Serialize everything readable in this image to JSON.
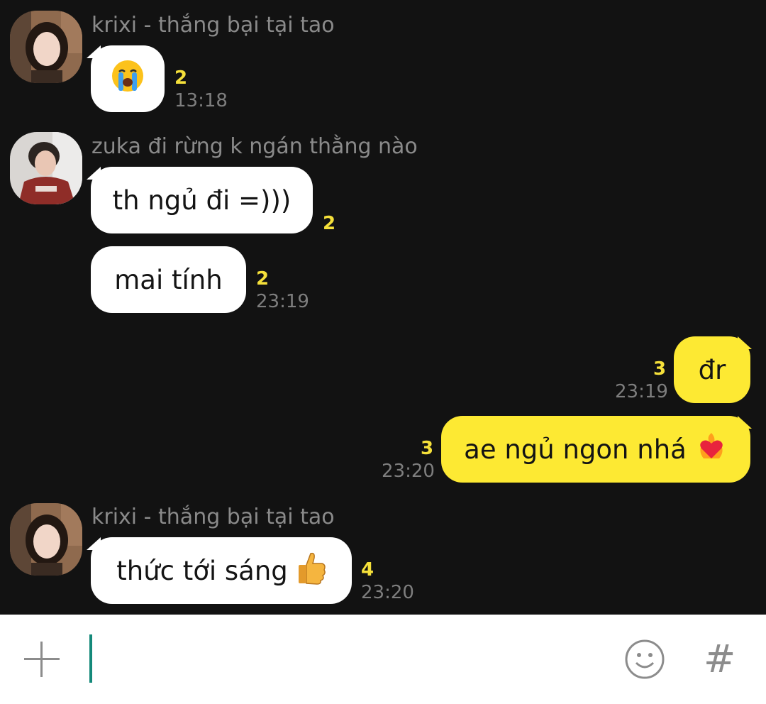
{
  "messages": [
    {
      "sender": "krixi - thắng bại tại tao",
      "text": "",
      "icon": "loudly-crying-face-emoji",
      "count": "2",
      "time": "13:18"
    },
    {
      "sender": "zuka đi rừng k ngán thằng nào",
      "text": "th ngủ đi =)))",
      "count": "2",
      "time": ""
    },
    {
      "sender": "",
      "text": "mai tính",
      "count": "2",
      "time": "23:19"
    },
    {
      "sender": "me",
      "text": "đr",
      "count": "3",
      "time": "23:19"
    },
    {
      "sender": "me",
      "text": "ae ngủ ngon nhá",
      "icon": "heart-on-fire-emoji",
      "count": "3",
      "time": "23:20"
    },
    {
      "sender": "krixi - thắng bại tại tao",
      "text": "thức tới sáng",
      "icon": "thumbs-up-emoji",
      "count": "4",
      "time": "23:20"
    }
  ],
  "input": {
    "value": "",
    "placeholder": ""
  },
  "toolbar": {
    "hash_label": "#"
  },
  "colors": {
    "background": "#121212",
    "incoming_bubble": "#ffffff",
    "outgoing_bubble": "#fde933",
    "unread_count": "#f5e03a",
    "timestamp": "#7e7e7e",
    "sender_name": "#8a8a8a",
    "caret": "#14897a"
  }
}
